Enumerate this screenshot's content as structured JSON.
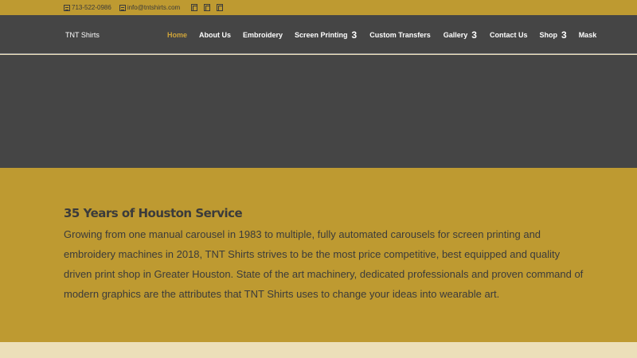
{
  "topbar": {
    "phone": "713-522-0986",
    "email": "info@tntshirts.com",
    "social_icons": [
      "facebook-icon",
      "twitter-icon",
      "instagram-icon"
    ]
  },
  "header": {
    "logo": "TNT Shirts",
    "nav": [
      {
        "label": "Home",
        "active": true
      },
      {
        "label": "About Us"
      },
      {
        "label": "Embroidery"
      },
      {
        "label": "Screen Printing",
        "dropdown": "3"
      },
      {
        "label": "Custom Transfers"
      },
      {
        "label": "Gallery",
        "dropdown": "3"
      },
      {
        "label": "Contact Us"
      },
      {
        "label": "Shop",
        "dropdown": "3"
      },
      {
        "label": "Mask"
      }
    ]
  },
  "content": {
    "heading": "35 Years of Houston Service",
    "body": "Growing from one manual carousel in 1983 to multiple, fully automated carousels for screen printing and embroidery machines in 2018, TNT Shirts  strives to be the most price competitive, best equipped and quality driven print shop in Greater Houston. State of the art machinery, dedicated professionals and proven command of modern graphics are the attributes that TNT Shirts uses to change your ideas into wearable art."
  },
  "colors": {
    "gold": "#be9a31",
    "dark": "#454545",
    "active_nav": "#cfa43a",
    "cream": "#ecdfb9"
  }
}
